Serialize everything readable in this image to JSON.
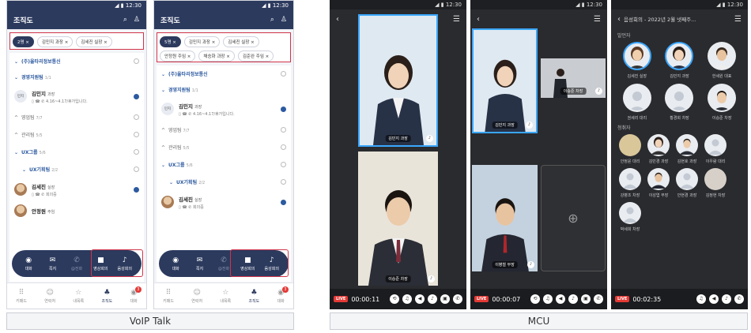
{
  "status_time": "12:30",
  "voip": {
    "title": "조직도",
    "chips_a": [
      {
        "label": "2명",
        "count": true
      },
      {
        "label": "김민지 과장"
      },
      {
        "label": "김세진 실장"
      }
    ],
    "chips_b": [
      {
        "label": "5명",
        "count": true
      },
      {
        "label": "김민지 과장"
      },
      {
        "label": "김세진 실장"
      },
      {
        "label": "안정원 주임"
      },
      {
        "label": "채승화 과장"
      },
      {
        "label": "김준완 주임"
      }
    ],
    "company": "(주)울타리정보통신",
    "dept1": "경영지원팀",
    "dept1_count": "1/1",
    "person1_avatar": "민지",
    "person1_name": "김민지",
    "person1_rank": "과장",
    "person1_status": "4.16~4.17/휴가입니다.",
    "dept2": "영업팀",
    "dept2_count": "7/7",
    "dept3": "관리팀",
    "dept3_count": "5/5",
    "dept4": "UX그룹",
    "dept4_count": "5/6",
    "dept5": "UX기획팀",
    "dept5_count": "2/2",
    "person2_name": "김세진",
    "person2_rank": "실장",
    "person2_status": "회의중",
    "person3_name": "안정원",
    "person3_rank": "주임",
    "actions": [
      "대화",
      "쪽지",
      "@전화",
      "영상회의",
      "음성회의"
    ],
    "nav": [
      "키패드",
      "연락처",
      "내목록",
      "조직도",
      "대화"
    ],
    "nav_badge": "3",
    "caption": "VoIP Talk"
  },
  "mcu": {
    "screen1": {
      "v1": "김민지 과장",
      "v2": "이승준 차장",
      "time": "00:00:11"
    },
    "screen2": {
      "v1": "김민지 과장",
      "v2": "이승준 차장",
      "v3": "이병철 부장",
      "time": "00:00:07"
    },
    "screen3": {
      "title": "음성회의 - 2022년 2월 넷째주...",
      "sec1": "발언자",
      "speakers": [
        "김세진 실장",
        "김민지 과장",
        "한세원 대표",
        "권세리 대리",
        "황경희 차장",
        "이승준 차장"
      ],
      "sec2": "청취자",
      "listeners": [
        "안정윤 대리",
        "김민경 과장",
        "김현호 과장",
        "이우람 대리",
        "강병조 차장",
        "이성엽 부장",
        "안현경 과장",
        "김정현 차장",
        "박세희 차장"
      ],
      "time": "00:02:35"
    },
    "live": "LIVE",
    "caption": "MCU"
  },
  "colors": {
    "navy": "#2c3a5e",
    "accent": "#3aa7ff",
    "red": "#d1344a"
  }
}
